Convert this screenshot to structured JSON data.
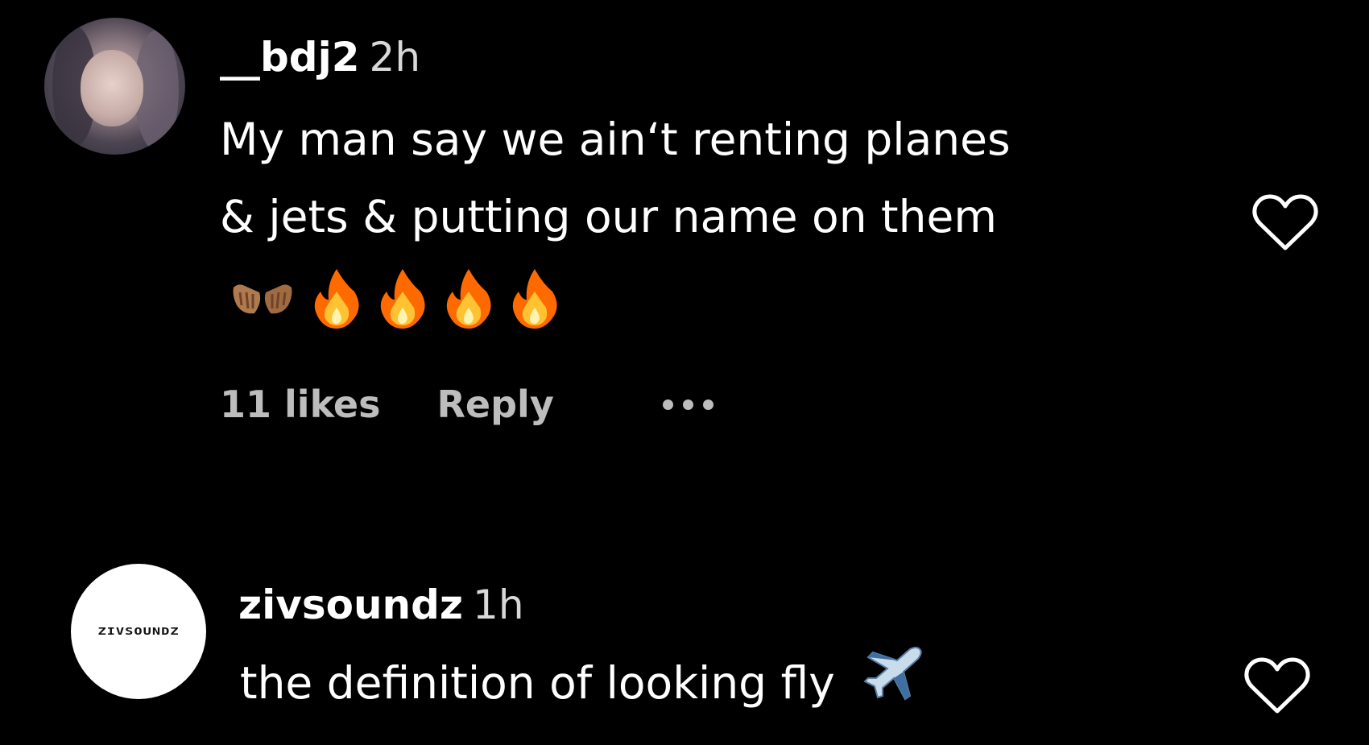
{
  "comments": [
    {
      "username": "__bdj2",
      "time": "2h",
      "text_line1": "My man say we ain‘t renting planes",
      "text_line2": "& jets & putting our name on them",
      "emojis": [
        "palms-up-together-icon",
        "fire-icon",
        "fire-icon",
        "fire-icon",
        "fire-icon"
      ],
      "likes": "11 likes",
      "reply_label": "Reply",
      "more_icon": "ellipsis-icon",
      "like_icon": "heart-outline-icon"
    },
    {
      "username": "zivsoundz",
      "time": "1h",
      "text": "the definition of looking fly",
      "emoji": "airplane-icon",
      "avatar_logo_text": "ZIVSOUNDZ",
      "like_icon": "heart-outline-icon"
    }
  ],
  "colors": {
    "background": "#000000",
    "text": "#ffffff",
    "secondary_text": "#bdbdbd",
    "timestamp": "#d8d8d8"
  }
}
